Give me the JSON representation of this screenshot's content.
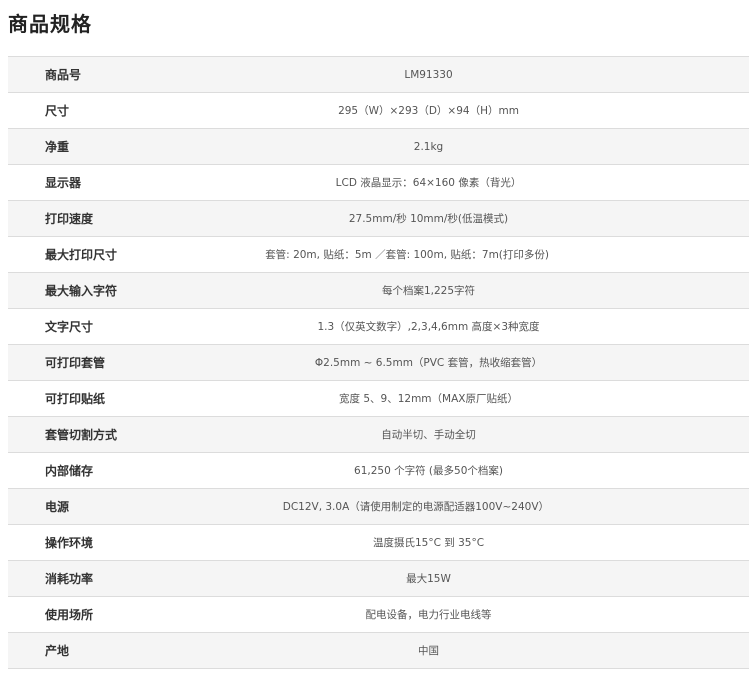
{
  "title": "商品规格",
  "specs": [
    {
      "label": "商品号",
      "value": "LM91330"
    },
    {
      "label": "尺寸",
      "value": "295（W）×293（D）×94（H）mm"
    },
    {
      "label": "净重",
      "value": "2.1kg"
    },
    {
      "label": "显示器",
      "value": "LCD 液晶显示：64×160 像素（背光）"
    },
    {
      "label": "打印速度",
      "value": "27.5mm/秒 10mm/秒(低温模式)"
    },
    {
      "label": "最大打印尺寸",
      "value": "套管: 20m, 贴纸：5m ／套管: 100m, 贴纸：7m(打印多份)"
    },
    {
      "label": "最大输入字符",
      "value": "每个档案1,225字符"
    },
    {
      "label": "文字尺寸",
      "value": "1.3（仅英文数字）,2,3,4,6mm 高度×3种宽度"
    },
    {
      "label": "可打印套管",
      "value": "Φ2.5mm ~ 6.5mm（PVC 套管，热收缩套管）"
    },
    {
      "label": "可打印贴纸",
      "value": "宽度 5、9、12mm（MAX原厂贴纸）"
    },
    {
      "label": "套管切割方式",
      "value": "自动半切、手动全切"
    },
    {
      "label": "内部储存",
      "value": "61,250 个字符 (最多50个档案)"
    },
    {
      "label": "电源",
      "value": "DC12V, 3.0A（请使用制定的电源配适器100V~240V）"
    },
    {
      "label": "操作环境",
      "value": "温度摄氏15°C 到 35°C"
    },
    {
      "label": "消耗功率",
      "value": "最大15W"
    },
    {
      "label": "使用场所",
      "value": "配电设备，电力行业电线等"
    },
    {
      "label": "产地",
      "value": "中国"
    }
  ]
}
